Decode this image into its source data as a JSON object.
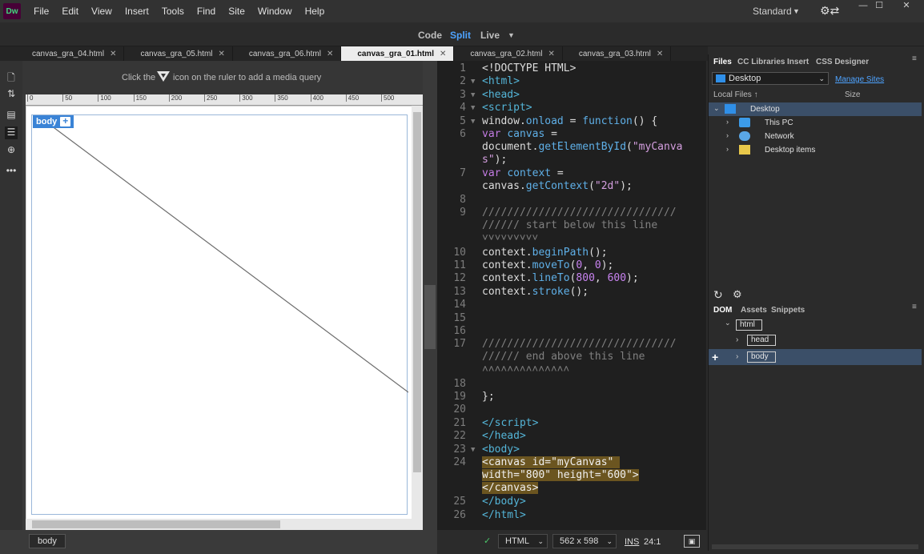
{
  "app": {
    "logo_text": "Dw"
  },
  "menu": [
    "File",
    "Edit",
    "View",
    "Insert",
    "Tools",
    "Find",
    "Site",
    "Window",
    "Help"
  ],
  "workspace": {
    "label": "Standard"
  },
  "view_switcher": {
    "code": "Code",
    "split": "Split",
    "live": "Live",
    "active": "Split"
  },
  "tabs": [
    {
      "label": "canvas_gra_04.html",
      "active": false
    },
    {
      "label": "canvas_gra_05.html",
      "active": false
    },
    {
      "label": "canvas_gra_06.html",
      "active": false
    },
    {
      "label": "canvas_gra_01.html",
      "active": true
    },
    {
      "label": "canvas_gra_02.html",
      "active": false
    },
    {
      "label": "canvas_gra_03.html",
      "active": false
    }
  ],
  "design": {
    "mq_hint_before": "Click the",
    "mq_hint_after": "icon on the ruler to add a media query",
    "ruler_ticks": [
      "0",
      "50",
      "100",
      "150",
      "200",
      "250",
      "300",
      "350",
      "400",
      "450",
      "500"
    ],
    "element_tag": "body",
    "element_plus": "+"
  },
  "code": {
    "lines": [
      {
        "n": "1",
        "fold": "",
        "html": "&lt;!DOCTYPE HTML&gt;"
      },
      {
        "n": "2",
        "fold": "▼",
        "html": "<span class='tag'>&lt;html&gt;</span>"
      },
      {
        "n": "3",
        "fold": "▼",
        "html": "<span class='tag'>&lt;head&gt;</span>"
      },
      {
        "n": "4",
        "fold": "▼",
        "html": "<span class='tag'>&lt;script&gt;</span>"
      },
      {
        "n": "5",
        "fold": "▼",
        "html": "window.<span class='fn'>onload</span> = <span class='fn'>function</span>() {"
      },
      {
        "n": "6",
        "fold": "",
        "html": "<span class='kw'>var</span> <span class='fn'>canvas</span> =\ndocument.<span class='fn'>getElementById</span>(<span class='str'>\"myCanva\ns\"</span>);"
      },
      {
        "n": "7",
        "fold": "",
        "html": "<span class='kw'>var</span> <span class='fn'>context</span> =\ncanvas.<span class='fn'>getContext</span>(<span class='str'>\"2d\"</span>);"
      },
      {
        "n": "8",
        "fold": "",
        "html": ""
      },
      {
        "n": "9",
        "fold": "",
        "html": "<span class='cm'>///////////////////////////////\n////// start below this line\n˅˅˅˅˅˅˅˅˅</span>"
      },
      {
        "n": "10",
        "fold": "",
        "html": "context.<span class='fn'>beginPath</span>();"
      },
      {
        "n": "11",
        "fold": "",
        "html": "context.<span class='fn'>moveTo</span>(<span class='num'>0</span>, <span class='num'>0</span>);"
      },
      {
        "n": "12",
        "fold": "",
        "html": "context.<span class='fn'>lineTo</span>(<span class='num'>800</span>, <span class='num'>600</span>);"
      },
      {
        "n": "13",
        "fold": "",
        "html": "context.<span class='fn'>stroke</span>();"
      },
      {
        "n": "14",
        "fold": "",
        "html": ""
      },
      {
        "n": "15",
        "fold": "",
        "html": ""
      },
      {
        "n": "16",
        "fold": "",
        "html": ""
      },
      {
        "n": "17",
        "fold": "",
        "html": "<span class='cm'>///////////////////////////////\n////// end above this line\n˄˄˄˄˄˄˄˄˄˄˄˄˄˄</span>"
      },
      {
        "n": "18",
        "fold": "",
        "html": ""
      },
      {
        "n": "19",
        "fold": "",
        "html": "};"
      },
      {
        "n": "20",
        "fold": "",
        "html": ""
      },
      {
        "n": "21",
        "fold": "",
        "html": "<span class='tag'>&lt;/script&gt;</span>"
      },
      {
        "n": "22",
        "fold": "",
        "html": "<span class='tag'>&lt;/head&gt;</span>"
      },
      {
        "n": "23",
        "fold": "▼",
        "html": "<span class='tag'>&lt;body&gt;</span>"
      },
      {
        "n": "24",
        "fold": "",
        "html": "<span class='hl'>&lt;canvas id=\"myCanvas\" \nwidth=\"800\" height=\"600\"&gt;\n&lt;/canvas&gt;</span>"
      },
      {
        "n": "25",
        "fold": "",
        "html": "<span class='tag'>&lt;/body&gt;</span>"
      },
      {
        "n": "26",
        "fold": "",
        "html": "<span class='tag'>&lt;/html&gt;</span>"
      }
    ]
  },
  "files_panel": {
    "tabs": [
      "Files",
      "CC Libraries",
      "Insert",
      "CSS Designer"
    ],
    "location": "Desktop",
    "manage_sites": "Manage Sites",
    "local_files_header": "Local Files",
    "size_header": "Size",
    "tree": [
      {
        "label": "Desktop",
        "icon": "desktop-icon",
        "selected": true
      },
      {
        "label": "This PC",
        "icon": "computer-icon",
        "selected": false
      },
      {
        "label": "Network",
        "icon": "network-icon",
        "selected": false
      },
      {
        "label": "Desktop items",
        "icon": "folder-icon",
        "selected": false
      }
    ]
  },
  "dom_panel": {
    "tabs": [
      "DOM",
      "Assets",
      "Snippets"
    ],
    "nodes": [
      "html",
      "head",
      "body"
    ]
  },
  "status": {
    "tag_selector": "body",
    "doc_type": "HTML",
    "window_size": "562 x 598",
    "insert_mode": "INS",
    "cursor": "24:1"
  }
}
